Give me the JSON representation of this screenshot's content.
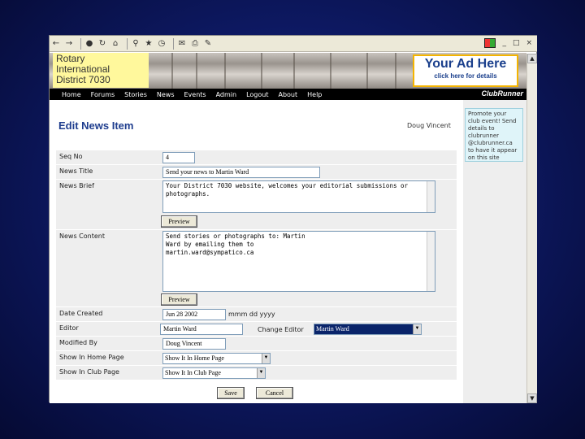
{
  "toolbar": {
    "icons": [
      "back-icon",
      "forward-icon",
      "stop-icon",
      "refresh-icon",
      "home-icon",
      "search-icon",
      "favorites-icon",
      "history-icon",
      "mail-icon",
      "print-icon",
      "edit-icon"
    ],
    "window_controls": [
      "_",
      "□",
      "×"
    ]
  },
  "banner": {
    "district_lines": [
      "Rotary",
      "International",
      "District 7030"
    ],
    "ad_title": "Your Ad Here",
    "ad_subtitle": "click here for details"
  },
  "nav": {
    "items": [
      "Home",
      "Forums",
      "Stories",
      "News",
      "Events",
      "Admin",
      "Logout",
      "About",
      "Help"
    ],
    "brand": "ClubRunner"
  },
  "sidebar": {
    "promo_text": "Promote your club event! Send details to clubrunner @clubrunner.ca to have it appear on this site"
  },
  "page": {
    "title": "Edit News Item",
    "user": "Doug Vincent"
  },
  "form": {
    "seq_label": "Seq No",
    "seq_value": "4",
    "title_label": "News Title",
    "title_value": "Send your news to Martin Ward",
    "brief_label": "News Brief",
    "brief_value": "Your District 7030 website, welcomes your editorial submissions or photographs.",
    "content_label": "News Content",
    "content_value": "Send stories or photographs to: Martin Ward by emailing them to martin.ward@sympatico.ca",
    "preview_label": "Preview",
    "date_label": "Date Created",
    "date_value": "Jun 28 2002",
    "date_hint": "mmm dd yyyy",
    "editor_label": "Editor",
    "editor_value": "Martin Ward",
    "change_editor_label": "Change Editor",
    "change_editor_value": "Martin Ward",
    "modified_label": "Modified By",
    "modified_value": "Doug Vincent",
    "home_label": "Show In Home Page",
    "home_value": "Show It In Home Page",
    "club_label": "Show In Club Page",
    "club_value": "Show It In Club Page",
    "save_label": "Save",
    "cancel_label": "Cancel"
  }
}
